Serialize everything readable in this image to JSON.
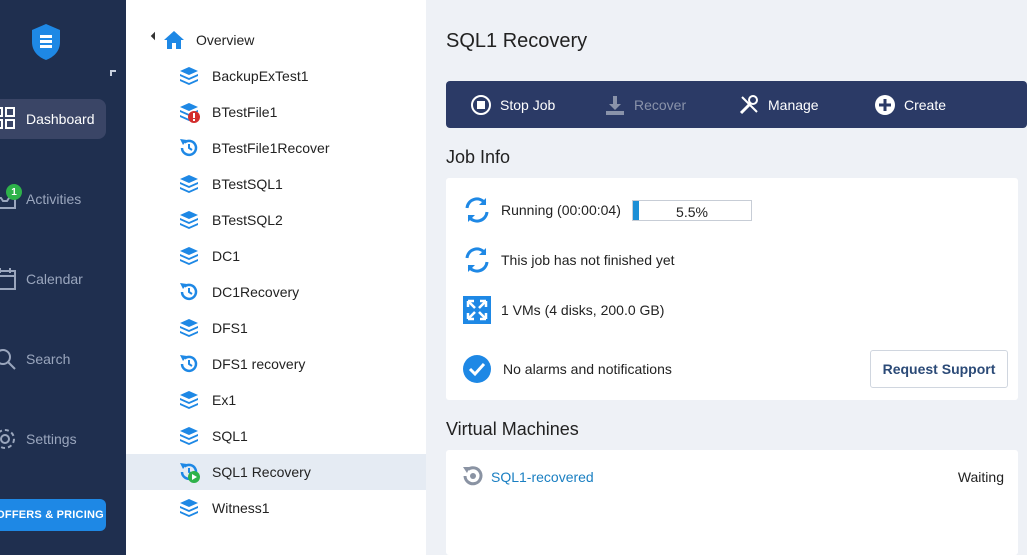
{
  "nav": {
    "items": [
      {
        "label": "Dashboard",
        "icon": "grid-icon",
        "active": true
      },
      {
        "label": "Activities",
        "icon": "inbox-icon",
        "active": false
      },
      {
        "label": "Calendar",
        "icon": "calendar-icon",
        "active": false
      },
      {
        "label": "Search",
        "icon": "search-icon",
        "active": false
      },
      {
        "label": "Settings",
        "icon": "gear-icon",
        "active": false
      }
    ],
    "activities_badge": "1",
    "offers_label": "OFFERS & PRICING"
  },
  "tree": {
    "root_label": "Overview",
    "items": [
      {
        "label": "BackupExTest1",
        "icon": "backup-job-icon"
      },
      {
        "label": "BTestFile1",
        "icon": "backup-job-error-icon"
      },
      {
        "label": "BTestFile1Recover",
        "icon": "recovery-job-icon"
      },
      {
        "label": "BTestSQL1",
        "icon": "backup-job-icon"
      },
      {
        "label": "BTestSQL2",
        "icon": "backup-job-icon"
      },
      {
        "label": "DC1",
        "icon": "backup-job-icon"
      },
      {
        "label": "DC1Recovery",
        "icon": "recovery-job-icon"
      },
      {
        "label": "DFS1",
        "icon": "backup-job-icon"
      },
      {
        "label": "DFS1 recovery",
        "icon": "recovery-job-icon"
      },
      {
        "label": "Ex1",
        "icon": "backup-job-icon"
      },
      {
        "label": "SQL1",
        "icon": "backup-job-icon"
      },
      {
        "label": "SQL1 Recovery",
        "icon": "recovery-job-running-icon",
        "selected": true
      },
      {
        "label": "Witness1",
        "icon": "backup-job-icon"
      }
    ]
  },
  "main": {
    "title": "SQL1 Recovery",
    "toolbar": {
      "stop_job": "Stop Job",
      "recover": "Recover",
      "manage": "Manage",
      "create": "Create"
    },
    "job_info": {
      "heading": "Job Info",
      "running_text": "Running (00:00:04)",
      "progress_percent": 5.5,
      "progress_label": "5.5%",
      "not_finished_text": "This job has not finished yet",
      "vms_text": "1 VMs (4 disks, 200.0 GB)",
      "alarms_text": "No alarms and notifications",
      "request_support": "Request Support"
    },
    "virtual_machines": {
      "heading": "Virtual Machines",
      "items": [
        {
          "name": "SQL1-recovered",
          "status": "Waiting"
        }
      ]
    }
  },
  "colors": {
    "nav_bg": "#1f2f4f",
    "toolbar_bg": "#2b3a66",
    "accent": "#1e88e5",
    "link": "#1a7fc2",
    "badge_green": "#2eb24a"
  }
}
